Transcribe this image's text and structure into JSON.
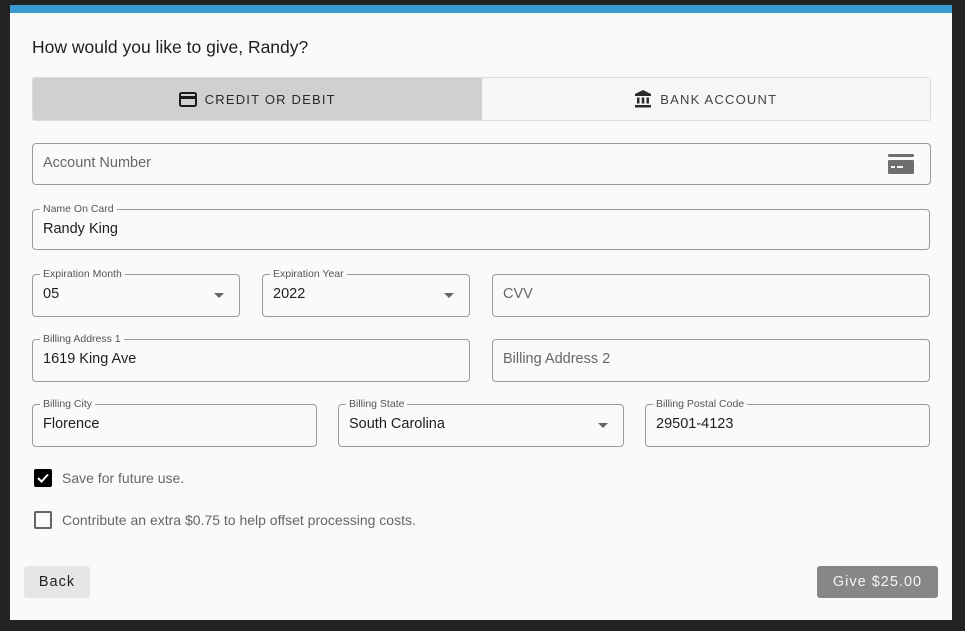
{
  "colors": {
    "accent_bar": "#3a9bd0",
    "active_tab": "#d0d0d0",
    "give_button": "#878787",
    "background": "#232323"
  },
  "header": {
    "title": "How would you like to give, Randy?"
  },
  "tabs": [
    {
      "label": "CREDIT OR DEBIT",
      "icon": "credit-card-icon",
      "active": true
    },
    {
      "label": "BANK ACCOUNT",
      "icon": "bank-icon",
      "active": false
    }
  ],
  "form": {
    "account_number": {
      "placeholder": "Account Number",
      "value": "",
      "icon": "credit-card-icon"
    },
    "name_on_card": {
      "label": "Name On Card",
      "value": "Randy King"
    },
    "expiration_month": {
      "label": "Expiration Month",
      "value": "05"
    },
    "expiration_year": {
      "label": "Expiration Year",
      "value": "2022"
    },
    "cvv": {
      "placeholder": "CVV",
      "value": ""
    },
    "billing_address_1": {
      "label": "Billing Address 1",
      "value": "1619 King Ave"
    },
    "billing_address_2": {
      "placeholder": "Billing Address 2",
      "value": ""
    },
    "billing_city": {
      "label": "Billing City",
      "value": "Florence"
    },
    "billing_state": {
      "label": "Billing State",
      "value": "South Carolina"
    },
    "billing_postal_code": {
      "label": "Billing Postal Code",
      "value": "29501-4123"
    }
  },
  "options": {
    "save_for_future": {
      "label": "Save for future use.",
      "checked": true
    },
    "cover_fees": {
      "label": "Contribute an extra $0.75 to help offset processing costs.",
      "checked": false
    }
  },
  "footer": {
    "back_label": "Back",
    "give_label": "Give $25.00"
  }
}
